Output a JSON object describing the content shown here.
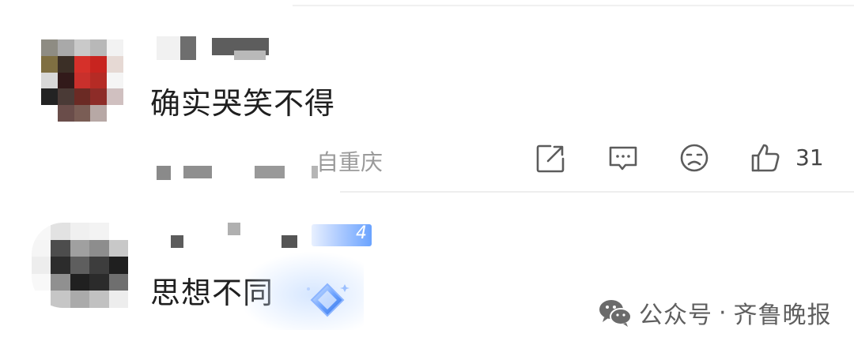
{
  "comments": [
    {
      "text": "确实哭笑不得",
      "location": "自重庆",
      "likes": "31"
    },
    {
      "text": "思想不同",
      "badge": "4"
    }
  ],
  "watermark": {
    "separator": "·",
    "prefix": "公众号",
    "name": "齐鲁晚报"
  },
  "icons": [
    "share-icon",
    "comment-icon",
    "dislike-face-icon",
    "thumbs-up-icon",
    "wechat-icon",
    "diamond-gem-icon"
  ]
}
